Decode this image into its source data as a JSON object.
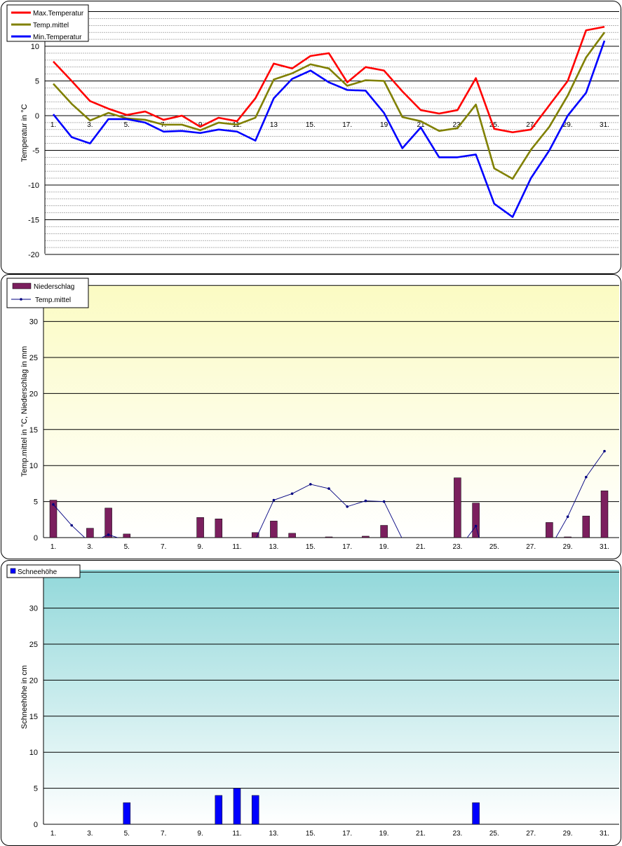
{
  "chart_data": [
    {
      "type": "line",
      "title": "",
      "ylabel": "Temperatur  in °C",
      "xlabel": "",
      "ylim": [
        -20,
        15
      ],
      "grid": true,
      "legend": "top-left",
      "x": [
        1,
        2,
        3,
        4,
        5,
        6,
        7,
        8,
        9,
        10,
        11,
        12,
        13,
        14,
        15,
        16,
        17,
        18,
        19,
        20,
        21,
        22,
        23,
        24,
        25,
        26,
        27,
        28,
        29,
        30,
        31
      ],
      "x_tick_labels": [
        "1.",
        "3.",
        "5.",
        "7.",
        "9",
        "11.",
        "13",
        "15.",
        "17.",
        "19",
        "21",
        "23.",
        "25.",
        "27.",
        "29.",
        "31."
      ],
      "y_tick_labels": [
        "-20",
        "-15",
        "-10",
        "-5",
        "0",
        "5",
        "10"
      ],
      "series": [
        {
          "name": "Max.Temperatur",
          "color": "#ff0000",
          "values": [
            7.8,
            5.0,
            2.1,
            1.0,
            0.1,
            0.6,
            -0.6,
            0.0,
            -1.6,
            -0.3,
            -0.8,
            2.5,
            7.5,
            6.8,
            8.6,
            9.0,
            4.8,
            7.0,
            6.5,
            3.5,
            0.8,
            0.3,
            0.8,
            5.4,
            -1.9,
            -2.4,
            -2.0,
            1.5,
            5.0,
            12.3,
            12.8
          ]
        },
        {
          "name": "Temp.mittel",
          "color": "#808000",
          "values": [
            4.6,
            1.7,
            -0.7,
            0.4,
            -0.4,
            -0.6,
            -1.3,
            -1.3,
            -2.1,
            -1.0,
            -1.3,
            -0.3,
            5.2,
            6.1,
            7.4,
            6.8,
            4.3,
            5.1,
            5.0,
            -0.2,
            -0.8,
            -2.2,
            -1.8,
            1.6,
            -7.6,
            -9.1,
            -4.9,
            -1.6,
            2.9,
            8.4,
            12.0
          ]
        },
        {
          "name": "Min.Temperatur",
          "color": "#0000ff",
          "values": [
            0.2,
            -3.1,
            -4.0,
            -0.5,
            -0.5,
            -1.0,
            -2.3,
            -2.2,
            -2.5,
            -2.0,
            -2.3,
            -3.6,
            2.5,
            5.3,
            6.5,
            4.8,
            3.7,
            3.6,
            0.4,
            -4.7,
            -1.7,
            -6.0,
            -6.0,
            -5.6,
            -12.7,
            -14.6,
            -9.0,
            -5.0,
            0.0,
            3.3,
            10.8
          ]
        }
      ]
    },
    {
      "type": "bar",
      "title": "",
      "ylabel": "Temp.mittel  in °C, Niederschlag in mm",
      "xlabel": "",
      "ylim": [
        0,
        35
      ],
      "grid": true,
      "legend": "top-left",
      "x": [
        1,
        2,
        3,
        4,
        5,
        6,
        7,
        8,
        9,
        10,
        11,
        12,
        13,
        14,
        15,
        16,
        17,
        18,
        19,
        20,
        21,
        22,
        23,
        24,
        25,
        26,
        27,
        28,
        29,
        30,
        31
      ],
      "x_tick_labels": [
        "1.",
        "3.",
        "5.",
        "7.",
        "9.",
        "11.",
        "13.",
        "15.",
        "17.",
        "19.",
        "21.",
        "23.",
        "25.",
        "27.",
        "29.",
        "31."
      ],
      "y_tick_labels": [
        "0",
        "5",
        "10",
        "15",
        "20",
        "25",
        "30"
      ],
      "series": [
        {
          "name": "Niederschlag",
          "type": "bar",
          "color": "#7b1f5e",
          "values": [
            5.2,
            0,
            1.3,
            4.1,
            0.5,
            0,
            0,
            0,
            2.8,
            2.6,
            0,
            0.7,
            2.3,
            0.6,
            0,
            0.1,
            0,
            0.2,
            1.7,
            0,
            0,
            0,
            8.3,
            4.8,
            0,
            0,
            0,
            2.1,
            0.1,
            3.0,
            6.5
          ]
        },
        {
          "name": "Temp.mittel",
          "type": "line",
          "color": "#000080",
          "values": [
            4.6,
            1.7,
            -0.7,
            0.4,
            -0.4,
            -0.6,
            -1.3,
            -1.3,
            -2.1,
            -1.0,
            -1.3,
            -0.3,
            5.2,
            6.1,
            7.4,
            6.8,
            4.3,
            5.1,
            5.0,
            -0.2,
            -0.8,
            -2.2,
            -1.8,
            1.6,
            -7.6,
            -9.1,
            -4.9,
            -1.6,
            2.9,
            8.4,
            12.0
          ]
        }
      ]
    },
    {
      "type": "bar",
      "title": "",
      "ylabel": "Schneehöhe in cm",
      "xlabel": "",
      "ylim": [
        0,
        35
      ],
      "grid": true,
      "legend": "top-left",
      "x": [
        1,
        2,
        3,
        4,
        5,
        6,
        7,
        8,
        9,
        10,
        11,
        12,
        13,
        14,
        15,
        16,
        17,
        18,
        19,
        20,
        21,
        22,
        23,
        24,
        25,
        26,
        27,
        28,
        29,
        30,
        31
      ],
      "x_tick_labels": [
        "1.",
        "3.",
        "5.",
        "7.",
        "9.",
        "11.",
        "13.",
        "15.",
        "17.",
        "19.",
        "21.",
        "23.",
        "25.",
        "27.",
        "29.",
        "31."
      ],
      "y_tick_labels": [
        "0",
        "5",
        "10",
        "15",
        "20",
        "25",
        "30"
      ],
      "series": [
        {
          "name": "Schneehöhe",
          "type": "bar",
          "color": "#0000ff",
          "values": [
            0,
            0,
            0,
            0,
            3,
            0,
            0,
            0,
            0,
            4,
            5,
            4,
            0,
            0,
            0,
            0,
            0,
            0,
            0,
            0,
            0,
            0,
            0,
            3,
            0,
            0,
            0,
            0,
            0,
            0,
            0
          ]
        }
      ]
    }
  ]
}
